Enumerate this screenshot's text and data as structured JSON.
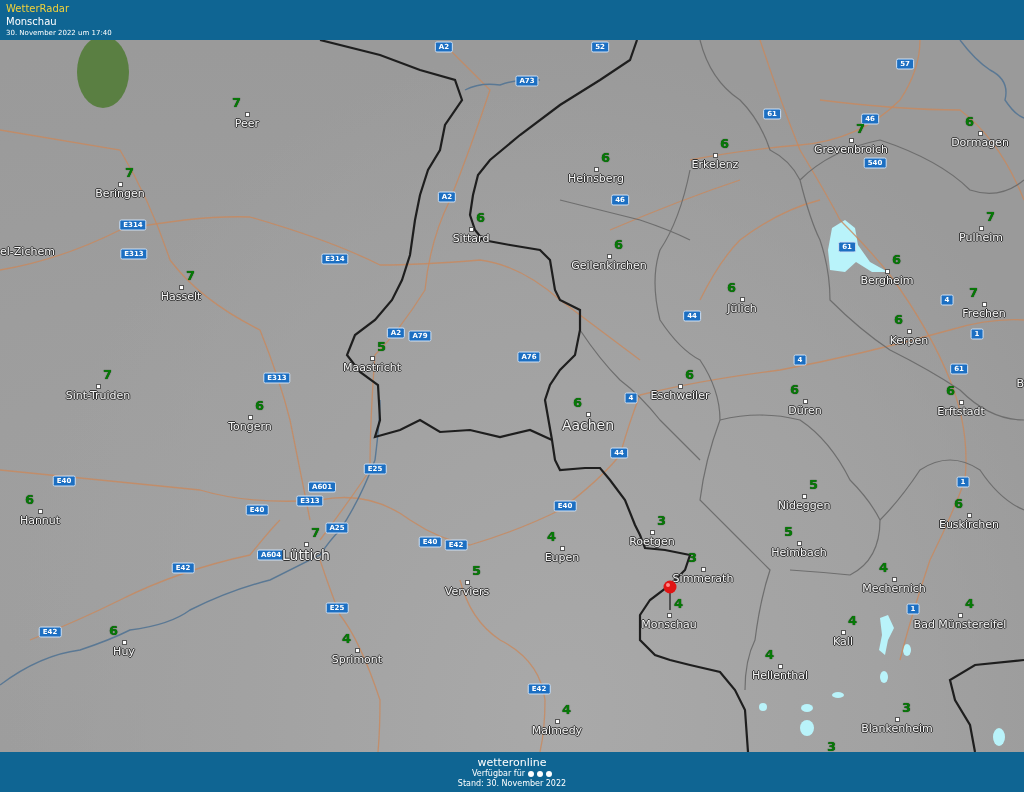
{
  "header": {
    "app_title": "WetterRadar",
    "location": "Monschau",
    "timestamp": "30. November 2022 um 17:40"
  },
  "map": {
    "places": [
      {
        "kind": "place",
        "name": "Peer",
        "value": "7"
      },
      {
        "kind": "place",
        "name": "Beringen",
        "value": "7"
      },
      {
        "kind": "edge",
        "name": "el-Zichem"
      },
      {
        "kind": "place",
        "name": "Hasselt",
        "value": "7"
      },
      {
        "kind": "place",
        "name": "Sint-Truiden",
        "value": "7"
      },
      {
        "kind": "place",
        "name": "Tongern",
        "value": "6"
      },
      {
        "kind": "place",
        "name": "Maastricht",
        "value": "5"
      },
      {
        "kind": "place",
        "name": "Sittard",
        "value": "6"
      },
      {
        "kind": "place",
        "name": "Heinsberg",
        "value": "6"
      },
      {
        "kind": "place",
        "name": "Erkelenz",
        "value": "6"
      },
      {
        "kind": "place",
        "name": "Grevenbroich",
        "value": "7"
      },
      {
        "kind": "place",
        "name": "Dormagen",
        "value": "6"
      },
      {
        "kind": "place",
        "name": "Geilenkirchen",
        "value": "6"
      },
      {
        "kind": "place",
        "name": "Jülich",
        "value": "6"
      },
      {
        "kind": "place",
        "name": "Bergheim",
        "value": "6"
      },
      {
        "kind": "place",
        "name": "Pulheim",
        "value": "7"
      },
      {
        "kind": "place",
        "name": "Frechen",
        "value": "7"
      },
      {
        "kind": "place",
        "name": "Kerpen",
        "value": "6"
      },
      {
        "kind": "major",
        "name": "Aachen",
        "value": "6"
      },
      {
        "kind": "place",
        "name": "Eschweiler",
        "value": "6"
      },
      {
        "kind": "place",
        "name": "Düren",
        "value": "6"
      },
      {
        "kind": "place",
        "name": "Erftstadt",
        "value": "6"
      },
      {
        "kind": "edge",
        "name": "B"
      },
      {
        "kind": "place",
        "name": "Hannut",
        "value": "6"
      },
      {
        "kind": "major",
        "name": "Lüttich",
        "value": "7"
      },
      {
        "kind": "place",
        "name": "Huy",
        "value": "6"
      },
      {
        "kind": "place",
        "name": "Sprimont",
        "value": "4"
      },
      {
        "kind": "place",
        "name": "Verviers",
        "value": "5"
      },
      {
        "kind": "place",
        "name": "Eupen",
        "value": "4"
      },
      {
        "kind": "place",
        "name": "Malmedy",
        "value": "4"
      },
      {
        "kind": "place",
        "name": "Roetgen",
        "value": "3"
      },
      {
        "kind": "place",
        "name": "Simmerath",
        "value": "3"
      },
      {
        "kind": "place",
        "name": "Monschau",
        "value": "4"
      },
      {
        "kind": "place",
        "name": "Nideggen",
        "value": "5"
      },
      {
        "kind": "place",
        "name": "Heimbach",
        "value": "5"
      },
      {
        "kind": "place",
        "name": "Euskirchen",
        "value": "6"
      },
      {
        "kind": "place",
        "name": "Mechernich",
        "value": "4"
      },
      {
        "kind": "place",
        "name": "Kall",
        "value": "4"
      },
      {
        "kind": "place",
        "name": "Bad Münstereifel",
        "value": "4"
      },
      {
        "kind": "place",
        "name": "Hellenthal",
        "value": "4"
      },
      {
        "kind": "place",
        "name": "Blankenheim",
        "value": "3"
      },
      {
        "kind": "value",
        "value": "3"
      }
    ],
    "road_shields": [
      "A2",
      "52",
      "A73",
      "57",
      "61",
      "46",
      "540",
      "46",
      "A2",
      "E314",
      "E313",
      "E314",
      "61",
      "A2",
      "A79",
      "A76",
      "44",
      "4",
      "1",
      "61",
      "4",
      "4",
      "E313",
      "44",
      "1",
      "E40",
      "E25",
      "A601",
      "E313",
      "E40",
      "A25",
      "A604",
      "E40",
      "E42",
      "E40",
      "E42",
      "E42",
      "E25",
      "1",
      "E42"
    ]
  },
  "footer": {
    "brand": "wetteronline",
    "availability": "Verfügbar für",
    "updated": "Stand: 30. November 2022"
  }
}
